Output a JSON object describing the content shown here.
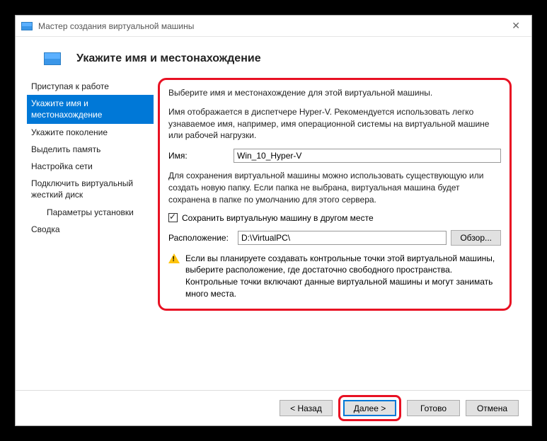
{
  "window": {
    "title": "Мастер создания виртуальной машины"
  },
  "heading": "Укажите имя и местонахождение",
  "sidebar": {
    "items": [
      "Приступая к работе",
      "Укажите имя и местонахождение",
      "Укажите поколение",
      "Выделить память",
      "Настройка сети",
      "Подключить виртуальный жесткий диск",
      "Параметры установки",
      "Сводка"
    ]
  },
  "content": {
    "intro": "Выберите имя и местонахождение для этой виртуальной машины.",
    "nameDesc": "Имя отображается в диспетчере Hyper-V. Рекомендуется использовать легко узнаваемое имя, например, имя операционной системы на виртуальной машине или рабочей нагрузки.",
    "nameLabel": "Имя:",
    "nameValue": "Win_10_Hyper-V",
    "saveDesc": "Для сохранения виртуальной машины можно использовать существующую или создать новую папку. Если папка не выбрана, виртуальная машина будет сохранена в папке по умолчанию для этого сервера.",
    "checkboxLabel": "Сохранить виртуальную машину в другом месте",
    "locationLabel": "Расположение:",
    "locationValue": "D:\\VirtualPC\\",
    "browseLabel": "Обзор...",
    "warning": "Если вы планируете создавать контрольные точки этой виртуальной машины, выберите расположение, где достаточно свободного пространства. Контрольные точки включают данные виртуальной машины и могут занимать много места."
  },
  "buttons": {
    "back": "< Назад",
    "next": "Далее >",
    "finish": "Готово",
    "cancel": "Отмена"
  }
}
